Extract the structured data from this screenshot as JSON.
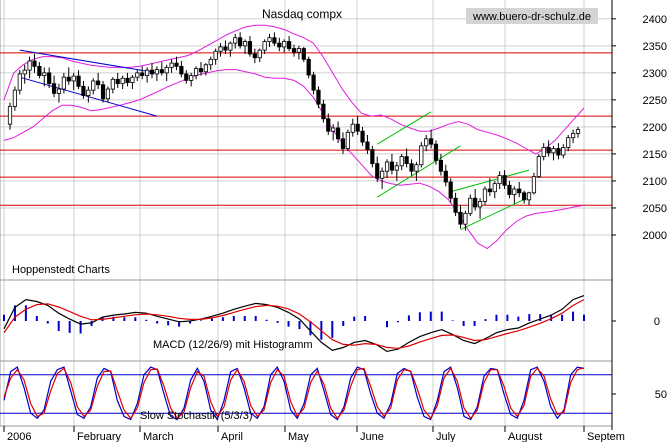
{
  "source_label": "www.buero-dr-schulz.de",
  "chart_data": [
    {
      "type": "candlestick",
      "title": "Nasdaq compx",
      "annotation": "Hoppenstedt Charts",
      "ylim": [
        1950,
        2420
      ],
      "y_ticks": [
        2000,
        2050,
        2100,
        2150,
        2200,
        2250,
        2300,
        2350,
        2400
      ],
      "x_labels": [
        "2006",
        "February",
        "March",
        "April",
        "May",
        "June",
        "July",
        "August",
        "Septem"
      ],
      "resistance_lines": [
        2337,
        2220,
        2157,
        2107,
        2055
      ],
      "colors": {
        "bollinger": "#e01ee0",
        "horizontal": "#dd0000",
        "trend_green": "#00bb00",
        "trend_blue": "#0000cc",
        "grid": "#cfcfcf"
      },
      "ohlc": [
        [
          2205,
          2245,
          2195,
          2238
        ],
        [
          2238,
          2275,
          2230,
          2268
        ],
        [
          2268,
          2305,
          2260,
          2298
        ],
        [
          2298,
          2315,
          2280,
          2305
        ],
        [
          2305,
          2330,
          2290,
          2322
        ],
        [
          2322,
          2335,
          2300,
          2312
        ],
        [
          2312,
          2320,
          2290,
          2295
        ],
        [
          2295,
          2310,
          2275,
          2300
        ],
        [
          2300,
          2310,
          2272,
          2280
        ],
        [
          2280,
          2295,
          2255,
          2262
        ],
        [
          2262,
          2280,
          2245,
          2270
        ],
        [
          2270,
          2300,
          2262,
          2292
        ],
        [
          2292,
          2310,
          2278,
          2285
        ],
        [
          2285,
          2300,
          2268,
          2294
        ],
        [
          2294,
          2305,
          2270,
          2275
        ],
        [
          2275,
          2285,
          2252,
          2258
        ],
        [
          2258,
          2275,
          2245,
          2268
        ],
        [
          2268,
          2290,
          2260,
          2285
        ],
        [
          2285,
          2300,
          2270,
          2278
        ],
        [
          2278,
          2285,
          2245,
          2252
        ],
        [
          2252,
          2275,
          2245,
          2270
        ],
        [
          2270,
          2292,
          2262,
          2288
        ],
        [
          2288,
          2300,
          2272,
          2280
        ],
        [
          2280,
          2295,
          2270,
          2290
        ],
        [
          2290,
          2300,
          2275,
          2282
        ],
        [
          2282,
          2296,
          2270,
          2292
        ],
        [
          2292,
          2305,
          2285,
          2300
        ],
        [
          2300,
          2312,
          2288,
          2295
        ],
        [
          2295,
          2310,
          2282,
          2305
        ],
        [
          2305,
          2318,
          2290,
          2298
        ],
        [
          2298,
          2312,
          2285,
          2306
        ],
        [
          2306,
          2320,
          2295,
          2300
        ],
        [
          2300,
          2315,
          2285,
          2310
        ],
        [
          2310,
          2325,
          2300,
          2318
        ],
        [
          2318,
          2330,
          2305,
          2312
        ],
        [
          2312,
          2322,
          2292,
          2298
        ],
        [
          2298,
          2305,
          2280,
          2286
        ],
        [
          2286,
          2300,
          2275,
          2295
        ],
        [
          2295,
          2312,
          2288,
          2308
        ],
        [
          2308,
          2320,
          2295,
          2302
        ],
        [
          2302,
          2318,
          2295,
          2315
        ],
        [
          2315,
          2330,
          2305,
          2325
        ],
        [
          2325,
          2345,
          2315,
          2340
        ],
        [
          2340,
          2355,
          2330,
          2348
        ],
        [
          2348,
          2360,
          2335,
          2342
        ],
        [
          2342,
          2358,
          2330,
          2355
        ],
        [
          2355,
          2372,
          2345,
          2365
        ],
        [
          2365,
          2375,
          2345,
          2350
        ],
        [
          2350,
          2362,
          2335,
          2358
        ],
        [
          2358,
          2368,
          2330,
          2335
        ],
        [
          2335,
          2345,
          2318,
          2328
        ],
        [
          2328,
          2345,
          2320,
          2342
        ],
        [
          2342,
          2362,
          2335,
          2358
        ],
        [
          2358,
          2372,
          2348,
          2365
        ],
        [
          2365,
          2375,
          2350,
          2355
        ],
        [
          2355,
          2365,
          2340,
          2348
        ],
        [
          2348,
          2362,
          2338,
          2358
        ],
        [
          2358,
          2368,
          2340,
          2345
        ],
        [
          2345,
          2352,
          2330,
          2338
        ],
        [
          2338,
          2350,
          2325,
          2345
        ],
        [
          2345,
          2348,
          2320,
          2325
        ],
        [
          2325,
          2330,
          2290,
          2296
        ],
        [
          2296,
          2302,
          2260,
          2268
        ],
        [
          2268,
          2275,
          2235,
          2242
        ],
        [
          2242,
          2250,
          2208,
          2215
        ],
        [
          2215,
          2225,
          2185,
          2192
        ],
        [
          2192,
          2205,
          2175,
          2198
        ],
        [
          2198,
          2210,
          2170,
          2178
        ],
        [
          2178,
          2190,
          2150,
          2160
        ],
        [
          2160,
          2195,
          2155,
          2190
        ],
        [
          2190,
          2215,
          2182,
          2205
        ],
        [
          2205,
          2220,
          2185,
          2192
        ],
        [
          2192,
          2200,
          2165,
          2172
        ],
        [
          2172,
          2185,
          2150,
          2158
        ],
        [
          2158,
          2165,
          2125,
          2132
        ],
        [
          2132,
          2145,
          2098,
          2105
        ],
        [
          2105,
          2125,
          2085,
          2118
        ],
        [
          2118,
          2140,
          2105,
          2135
        ],
        [
          2135,
          2150,
          2112,
          2120
        ],
        [
          2120,
          2135,
          2100,
          2128
        ],
        [
          2128,
          2150,
          2120,
          2145
        ],
        [
          2145,
          2160,
          2125,
          2132
        ],
        [
          2132,
          2140,
          2110,
          2118
        ],
        [
          2118,
          2135,
          2100,
          2130
        ],
        [
          2130,
          2172,
          2125,
          2165
        ],
        [
          2165,
          2185,
          2155,
          2178
        ],
        [
          2178,
          2195,
          2160,
          2168
        ],
        [
          2168,
          2175,
          2130,
          2138
        ],
        [
          2138,
          2150,
          2110,
          2118
        ],
        [
          2118,
          2130,
          2090,
          2098
        ],
        [
          2098,
          2105,
          2060,
          2068
        ],
        [
          2068,
          2078,
          2035,
          2042
        ],
        [
          2042,
          2055,
          2012,
          2020
        ],
        [
          2020,
          2045,
          2008,
          2040
        ],
        [
          2040,
          2075,
          2035,
          2068
        ],
        [
          2068,
          2085,
          2045,
          2052
        ],
        [
          2052,
          2068,
          2030,
          2062
        ],
        [
          2062,
          2090,
          2055,
          2085
        ],
        [
          2085,
          2105,
          2072,
          2080
        ],
        [
          2080,
          2100,
          2068,
          2095
        ],
        [
          2095,
          2118,
          2085,
          2110
        ],
        [
          2110,
          2120,
          2085,
          2092
        ],
        [
          2092,
          2100,
          2068,
          2075
        ],
        [
          2075,
          2090,
          2058,
          2085
        ],
        [
          2085,
          2098,
          2070,
          2078
        ],
        [
          2078,
          2082,
          2058,
          2065
        ],
        [
          2065,
          2080,
          2055,
          2078
        ],
        [
          2078,
          2115,
          2075,
          2108
        ],
        [
          2108,
          2150,
          2105,
          2145
        ],
        [
          2145,
          2170,
          2138,
          2162
        ],
        [
          2162,
          2175,
          2145,
          2152
        ],
        [
          2152,
          2165,
          2138,
          2160
        ],
        [
          2160,
          2170,
          2140,
          2148
        ],
        [
          2148,
          2168,
          2142,
          2162
        ],
        [
          2162,
          2185,
          2155,
          2180
        ],
        [
          2180,
          2195,
          2170,
          2188
        ],
        [
          2188,
          2200,
          2180,
          2195
        ]
      ],
      "bollinger_upper": [
        2250,
        2300,
        2315,
        2325,
        2330,
        2330,
        2328,
        2322,
        2318,
        2314,
        2312,
        2310,
        2310,
        2310,
        2312,
        2316,
        2320,
        2324,
        2328,
        2332,
        2340,
        2350,
        2360,
        2370,
        2378,
        2385,
        2388,
        2388,
        2385,
        2380,
        2372,
        2365,
        2355,
        2330,
        2300,
        2270,
        2245,
        2225,
        2220,
        2222,
        2215,
        2205,
        2198,
        2192,
        2192,
        2198,
        2205,
        2210,
        2205,
        2195,
        2190,
        2185,
        2178,
        2170,
        2160,
        2150,
        2160,
        2175,
        2195,
        2215,
        2235
      ],
      "bollinger_lower": [
        2175,
        2180,
        2190,
        2200,
        2215,
        2230,
        2240,
        2240,
        2236,
        2230,
        2232,
        2236,
        2240,
        2245,
        2250,
        2258,
        2266,
        2275,
        2282,
        2290,
        2296,
        2300,
        2304,
        2306,
        2306,
        2302,
        2298,
        2292,
        2290,
        2290,
        2286,
        2275,
        2255,
        2225,
        2195,
        2170,
        2150,
        2130,
        2110,
        2100,
        2095,
        2092,
        2094,
        2096,
        2090,
        2080,
        2065,
        2040,
        2010,
        1985,
        1975,
        1990,
        2010,
        2025,
        2035,
        2040,
        2042,
        2045,
        2048,
        2052,
        2055
      ]
    },
    {
      "type": "line",
      "title": "MACD (12/26/9) mit Histogramm",
      "ylim": [
        -1,
        1
      ],
      "y_ticks": [
        0
      ],
      "colors": {
        "macd": "#000000",
        "signal": "#dd0000",
        "histogram": "#0000cc"
      },
      "macd": [
        -0.2,
        0.35,
        0.55,
        0.5,
        0.4,
        0.2,
        0.05,
        -0.08,
        -0.05,
        0.1,
        0.15,
        0.18,
        0.22,
        0.2,
        0.12,
        0.05,
        -0.02,
        0.0,
        0.05,
        0.12,
        0.2,
        0.3,
        0.38,
        0.45,
        0.42,
        0.35,
        0.22,
        0.05,
        -0.25,
        -0.55,
        -0.75,
        -0.68,
        -0.55,
        -0.5,
        -0.6,
        -0.78,
        -0.72,
        -0.55,
        -0.4,
        -0.3,
        -0.22,
        -0.35,
        -0.5,
        -0.58,
        -0.45,
        -0.3,
        -0.22,
        -0.18,
        -0.05,
        0.05,
        0.15,
        0.3,
        0.55,
        0.65
      ],
      "signal": [
        -0.3,
        0.1,
        0.3,
        0.42,
        0.44,
        0.36,
        0.24,
        0.12,
        0.03,
        0.04,
        0.08,
        0.12,
        0.16,
        0.18,
        0.16,
        0.12,
        0.07,
        0.04,
        0.04,
        0.08,
        0.14,
        0.22,
        0.3,
        0.37,
        0.4,
        0.38,
        0.31,
        0.18,
        -0.02,
        -0.25,
        -0.48,
        -0.6,
        -0.62,
        -0.58,
        -0.6,
        -0.68,
        -0.7,
        -0.64,
        -0.54,
        -0.45,
        -0.37,
        -0.36,
        -0.42,
        -0.5,
        -0.48,
        -0.4,
        -0.32,
        -0.25,
        -0.16,
        -0.06,
        0.06,
        0.2,
        0.4,
        0.55
      ]
    },
    {
      "type": "line",
      "title": "Slow Stochastik (5/3/3)",
      "ylim": [
        0,
        100
      ],
      "y_ticks": [
        50
      ],
      "reference_lines": [
        80,
        20
      ],
      "colors": {
        "k": "#0000cc",
        "d": "#dd0000",
        "reference": "#0000cc"
      },
      "k": [
        40,
        85,
        92,
        60,
        20,
        12,
        25,
        70,
        88,
        92,
        55,
        18,
        12,
        30,
        75,
        90,
        85,
        40,
        15,
        10,
        35,
        80,
        92,
        88,
        50,
        15,
        10,
        28,
        72,
        90,
        70,
        25,
        10,
        40,
        85,
        90,
        60,
        20,
        12,
        30,
        80,
        92,
        70,
        25,
        12,
        35,
        80,
        90,
        55,
        18,
        10,
        30,
        75,
        92,
        88,
        50,
        20,
        12,
        35,
        82,
        90,
        85,
        45,
        15,
        10,
        40,
        85,
        92,
        60,
        15,
        10,
        30,
        78,
        90,
        88,
        50,
        18,
        12,
        40,
        88,
        92,
        70,
        30,
        12,
        25,
        80,
        92,
        90
      ],
      "d": [
        45,
        75,
        88,
        72,
        35,
        15,
        20,
        55,
        82,
        90,
        68,
        30,
        15,
        25,
        62,
        85,
        86,
        55,
        25,
        12,
        28,
        68,
        88,
        89,
        62,
        28,
        12,
        22,
        60,
        85,
        78,
        38,
        15,
        30,
        72,
        88,
        70,
        32,
        15,
        25,
        68,
        88,
        78,
        38,
        15,
        28,
        68,
        86,
        65,
        28,
        12,
        25,
        62,
        88,
        90,
        62,
        30,
        15,
        28,
        72,
        88,
        86,
        58,
        25,
        12,
        32,
        75,
        90,
        70,
        28,
        12,
        25,
        68,
        88,
        88,
        62,
        28,
        15,
        32,
        78,
        90,
        78,
        42,
        18,
        22,
        68,
        88,
        91
      ]
    }
  ]
}
